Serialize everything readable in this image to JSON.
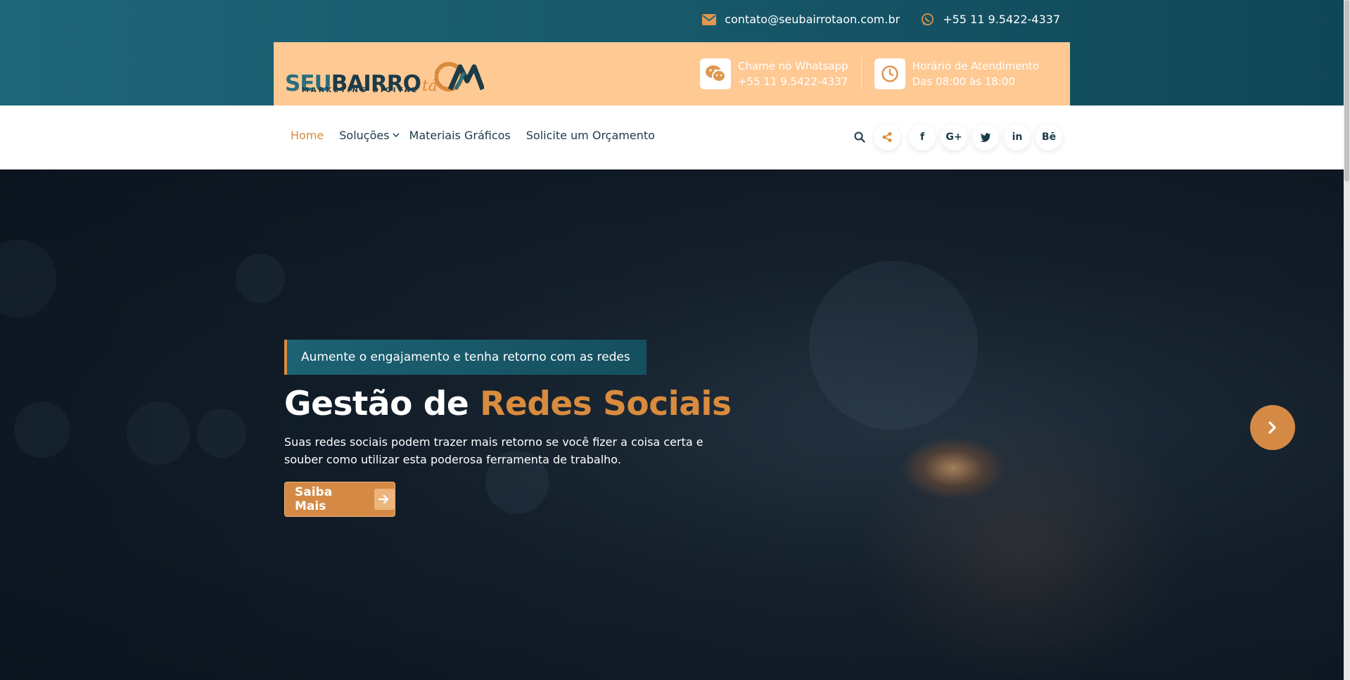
{
  "topbar": {
    "email": "contato@seubairrotaon.com.br",
    "phone": "+55 11 9.5422-4337",
    "email_icon": "envelope-icon",
    "phone_icon": "whatsapp-icon"
  },
  "brand": {
    "logo_seu": "SEU",
    "logo_bairro": "BAIRRO",
    "logo_ta": "tá",
    "logo_sub": "MARKETING DIGITAL"
  },
  "header_info": [
    {
      "title": "Chame no Whatsapp",
      "value": "+55 11 9.5422-4337",
      "icon": "wechat-icon"
    },
    {
      "title": "Horário de Atendimento",
      "value": "Das 08:00 às 18:00",
      "icon": "clock-icon"
    }
  ],
  "nav": {
    "items": [
      {
        "label": "Home",
        "active": true
      },
      {
        "label": "Soluções",
        "dropdown": true
      },
      {
        "label": "Materiais Gráficos"
      },
      {
        "label": "Solicite um Orçamento"
      }
    ],
    "social": [
      "share-icon",
      "facebook-icon",
      "google-plus-icon",
      "twitter-icon",
      "linkedin-icon",
      "behance-icon"
    ],
    "social_labels": {
      "facebook": "f",
      "google": "G+",
      "linkedin": "in",
      "behance": "Bē"
    }
  },
  "hero": {
    "tagline": "Aumente o engajamento e tenha retorno com as redes",
    "title_main": "Gestão de ",
    "title_accent": "Redes Sociais",
    "lead": "Suas redes sociais podem trazer mais retorno se você fizer a coisa certa e souber como utilizar esta poderosa ferramenta de trabalho.",
    "cta_label": "Saiba Mais"
  },
  "colors": {
    "accent": "#d98b3e",
    "teal": "#1c6274",
    "peach": "#ffc994",
    "navy": "#1b3b48"
  }
}
